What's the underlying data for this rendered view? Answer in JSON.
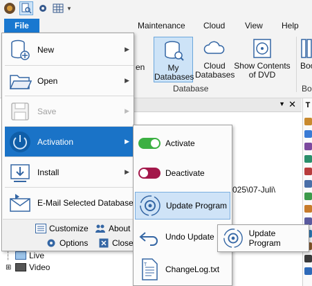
{
  "ribbon": {
    "tabs": [
      "Maintenance",
      "Cloud",
      "View",
      "Help"
    ],
    "buttons": {
      "partial_label": "en",
      "my_databases": "My\nDatabases",
      "my_databases_l1": "My",
      "my_databases_l2": "Databases",
      "cloud_databases_l1": "Cloud",
      "cloud_databases_l2": "Databases",
      "show_dvd_l1": "Show Contents",
      "show_dvd_l2": "of DVD",
      "partial_bo": "Boo"
    },
    "group_label": "Database",
    "partial_group": "Boo"
  },
  "background": {
    "path_fragment": "025\\07-Juli\\",
    "tree": [
      {
        "label": "Live"
      },
      {
        "label": "Video"
      }
    ]
  },
  "file_menu": {
    "tab_label": "File",
    "items": [
      {
        "label": "New",
        "icon": "new-database-icon",
        "has_submenu": true,
        "state": "normal"
      },
      {
        "label": "Open",
        "icon": "open-folder-icon",
        "has_submenu": true,
        "state": "normal"
      },
      {
        "label": "Save",
        "icon": "save-disk-icon",
        "has_submenu": true,
        "state": "disabled"
      },
      {
        "label": "Activation",
        "icon": "power-icon",
        "has_submenu": true,
        "state": "active"
      },
      {
        "label": "Install",
        "icon": "install-icon",
        "has_submenu": true,
        "state": "normal"
      },
      {
        "label": "E-Mail Selected Database",
        "icon": "email-icon",
        "has_submenu": false,
        "state": "normal"
      }
    ],
    "footer": {
      "customize": "Customize",
      "about": "About",
      "options": "Options",
      "close": "Close"
    }
  },
  "activation_submenu": {
    "items": [
      {
        "label": "Activate",
        "icon": "toggle-on-icon"
      },
      {
        "label": "Deactivate",
        "icon": "toggle-off-icon"
      },
      {
        "label": "Update Program",
        "icon": "update-gear-icon"
      },
      {
        "label": "Undo Update",
        "icon": "undo-arrow-icon"
      },
      {
        "label": "ChangeLog.txt",
        "icon": "text-file-icon"
      }
    ]
  },
  "update_submenu": {
    "items": [
      {
        "label": "Update Program",
        "icon": "update-gear-icon"
      }
    ]
  },
  "colors": {
    "accent": "#1978d0",
    "active_item": "#1a73c7",
    "toggle_on": "#3cb043",
    "toggle_off": "#a3174a",
    "hover_bg": "#cfe3f7"
  }
}
